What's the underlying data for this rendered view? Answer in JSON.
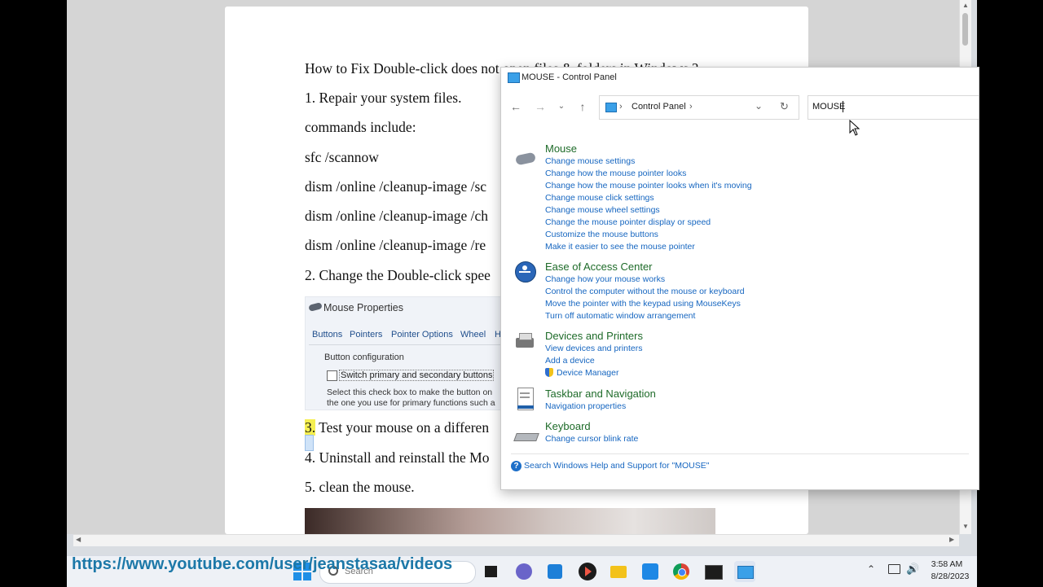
{
  "document": {
    "lines": [
      "How to Fix Double-click does not open files & folders in Windows ?",
      "1. Repair your system files.",
      "commands include:",
      "sfc /scannow",
      "dism /online /cleanup-image /sc",
      "dism /online /cleanup-image /ch",
      "dism /online /cleanup-image /re",
      "2. Change the Double-click spee"
    ],
    "line3_num": "3.",
    "line3_rest": " Test your mouse on a differen",
    "line4": "4. Uninstall and reinstall the Mo",
    "line5": "5. clean the mouse.",
    "mouse_props": {
      "title": "Mouse Properties",
      "tabs": [
        "Buttons",
        "Pointers",
        "Pointer Options",
        "Wheel",
        "H"
      ],
      "group": "Button configuration",
      "checkbox": "Switch primary and secondary buttons",
      "desc1": "Select this check box to make the button on",
      "desc2": "the one you use for primary functions such a"
    }
  },
  "control_panel": {
    "title": "MOUSE - Control Panel",
    "breadcrumb": "Control Panel",
    "search_value": "MOUSE",
    "categories": [
      {
        "title": "Mouse",
        "links": [
          "Change mouse settings",
          "Change how the mouse pointer looks",
          "Change how the mouse pointer looks when it's moving",
          "Change mouse click settings",
          "Change mouse wheel settings",
          "Change the mouse pointer display or speed",
          "Customize the mouse buttons",
          "Make it easier to see the mouse pointer"
        ]
      },
      {
        "title": "Ease of Access Center",
        "links": [
          "Change how your mouse works",
          "Control the computer without the mouse or keyboard",
          "Move the pointer with the keypad using MouseKeys",
          "Turn off automatic window arrangement"
        ]
      },
      {
        "title": "Devices and Printers",
        "links": [
          "View devices and printers",
          "Add a device",
          "Device Manager"
        ]
      },
      {
        "title": "Taskbar and Navigation",
        "links": [
          "Navigation properties"
        ]
      },
      {
        "title": "Keyboard",
        "links": [
          "Change cursor blink rate"
        ]
      }
    ],
    "help_text": "Search Windows Help and Support for \"MOUSE\""
  },
  "overlay_url": "https://www.youtube.com/user/jeanstasaa/videos",
  "taskbar": {
    "search_placeholder": "Search",
    "time": "3:58 AM",
    "date": "8/28/2023"
  },
  "colors": {
    "link": "#1666c0",
    "category": "#1e6b29",
    "url_overlay": "#1c78a8"
  }
}
